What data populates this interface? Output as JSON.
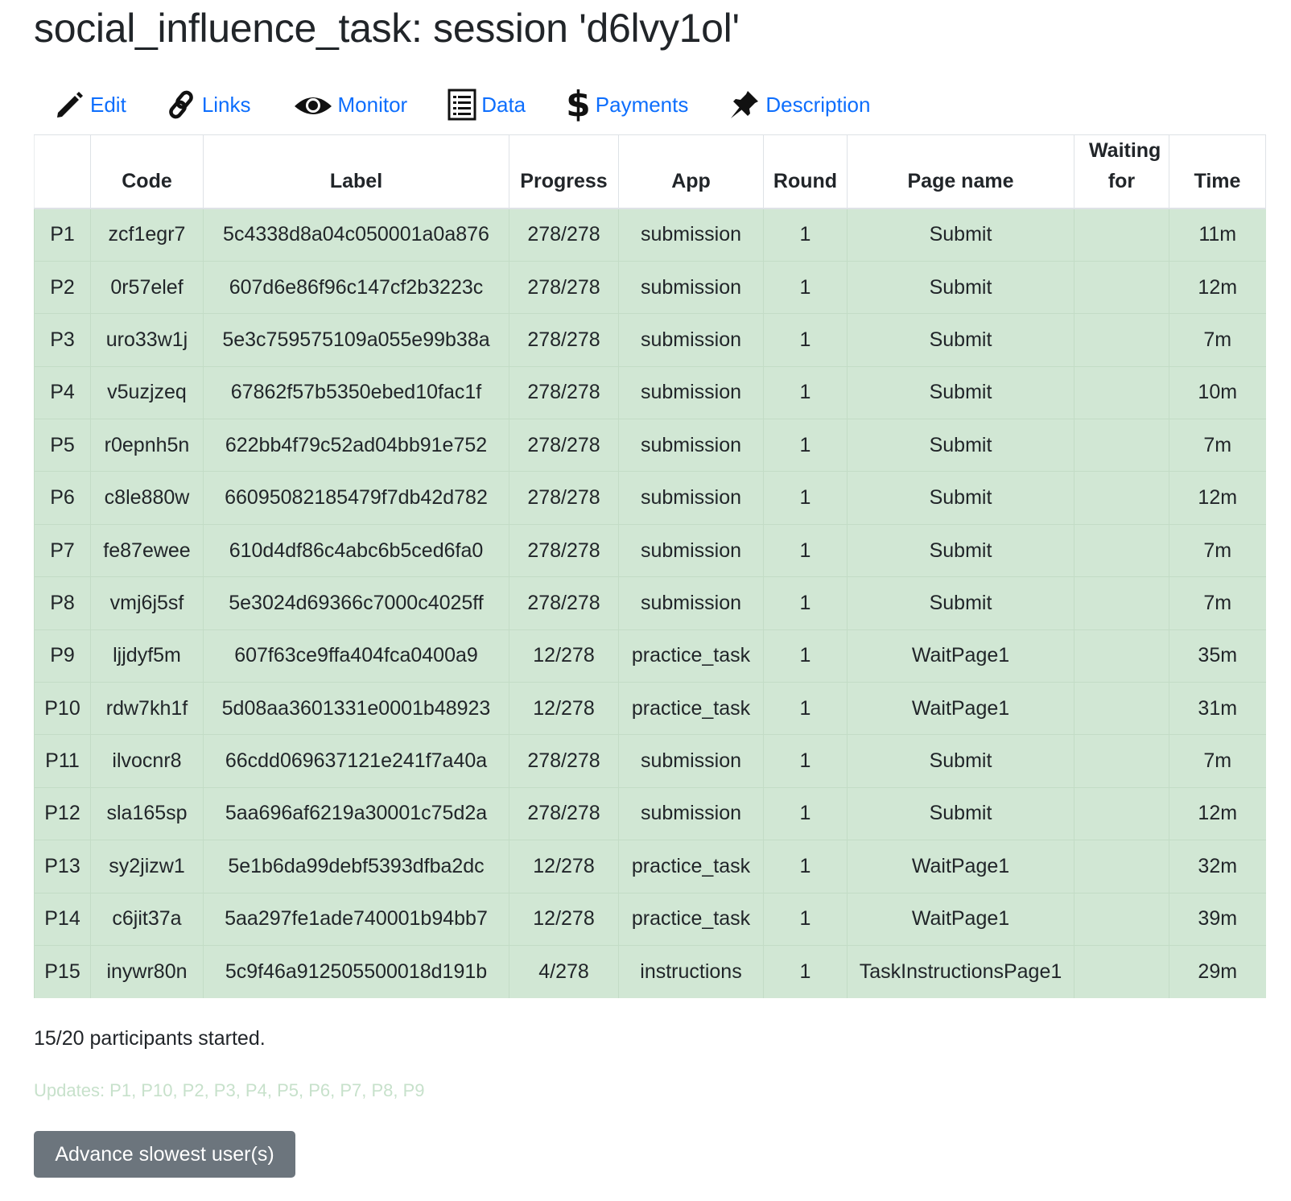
{
  "header": {
    "title": "social_influence_task: session 'd6lvy1ol'"
  },
  "nav": {
    "items": [
      {
        "label": "Edit",
        "icon": "pencil-icon"
      },
      {
        "label": "Links",
        "icon": "link-icon"
      },
      {
        "label": "Monitor",
        "icon": "eye-icon"
      },
      {
        "label": "Data",
        "icon": "list-icon"
      },
      {
        "label": "Payments",
        "icon": "dollar-icon"
      },
      {
        "label": "Description",
        "icon": "pin-icon"
      }
    ],
    "link_color": "#0d6efd"
  },
  "table": {
    "columns": [
      "",
      "Code",
      "Label",
      "Progress",
      "App",
      "Round",
      "Page name",
      "Waiting for",
      "Time"
    ],
    "rows": [
      [
        "P1",
        "zcf1egr7",
        "5c4338d8a04c050001a0a876",
        "278/278",
        "submission",
        "1",
        "Submit",
        "",
        "11m"
      ],
      [
        "P2",
        "0r57elef",
        "607d6e86f96c147cf2b3223c",
        "278/278",
        "submission",
        "1",
        "Submit",
        "",
        "12m"
      ],
      [
        "P3",
        "uro33w1j",
        "5e3c759575109a055e99b38a",
        "278/278",
        "submission",
        "1",
        "Submit",
        "",
        "7m"
      ],
      [
        "P4",
        "v5uzjzeq",
        "67862f57b5350ebed10fac1f",
        "278/278",
        "submission",
        "1",
        "Submit",
        "",
        "10m"
      ],
      [
        "P5",
        "r0epnh5n",
        "622bb4f79c52ad04bb91e752",
        "278/278",
        "submission",
        "1",
        "Submit",
        "",
        "7m"
      ],
      [
        "P6",
        "c8le880w",
        "66095082185479f7db42d782",
        "278/278",
        "submission",
        "1",
        "Submit",
        "",
        "12m"
      ],
      [
        "P7",
        "fe87ewee",
        "610d4df86c4abc6b5ced6fa0",
        "278/278",
        "submission",
        "1",
        "Submit",
        "",
        "7m"
      ],
      [
        "P8",
        "vmj6j5sf",
        "5e3024d69366c7000c4025ff",
        "278/278",
        "submission",
        "1",
        "Submit",
        "",
        "7m"
      ],
      [
        "P9",
        "ljjdyf5m",
        "607f63ce9ffa404fca0400a9",
        "12/278",
        "practice_task",
        "1",
        "WaitPage1",
        "",
        "35m"
      ],
      [
        "P10",
        "rdw7kh1f",
        "5d08aa3601331e0001b48923",
        "12/278",
        "practice_task",
        "1",
        "WaitPage1",
        "",
        "31m"
      ],
      [
        "P11",
        "ilvocnr8",
        "66cdd069637121e241f7a40a",
        "278/278",
        "submission",
        "1",
        "Submit",
        "",
        "7m"
      ],
      [
        "P12",
        "sla165sp",
        "5aa696af6219a30001c75d2a",
        "278/278",
        "submission",
        "1",
        "Submit",
        "",
        "12m"
      ],
      [
        "P13",
        "sy2jizw1",
        "5e1b6da99debf5393dfba2dc",
        "12/278",
        "practice_task",
        "1",
        "WaitPage1",
        "",
        "32m"
      ],
      [
        "P14",
        "c6jit37a",
        "5aa297fe1ade740001b94bb7",
        "12/278",
        "practice_task",
        "1",
        "WaitPage1",
        "",
        "39m"
      ],
      [
        "P15",
        "inywr80n",
        "5c9f46a912505500018d191b",
        "4/278",
        "instructions",
        "1",
        "TaskInstructionsPage1",
        "",
        "29m"
      ]
    ],
    "row_color": "#d1e7d4"
  },
  "summary": {
    "text": "15/20 participants started."
  },
  "updates": {
    "text": "Updates: P1, P10, P2, P3, P4, P5, P6, P7, P8, P9"
  },
  "actions": {
    "advance_label": "Advance slowest user(s)",
    "button_color": "#6c757d"
  }
}
